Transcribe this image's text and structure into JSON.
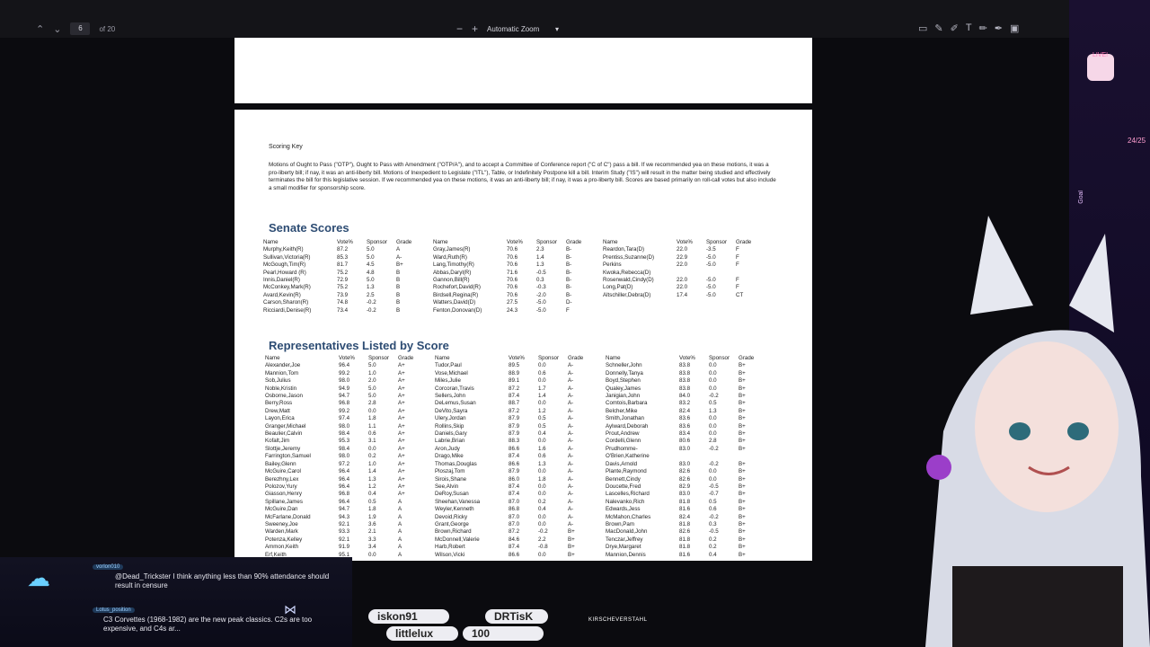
{
  "toolbar": {
    "page_current": "6",
    "page_total": "of 20",
    "zoom_label": "Automatic Zoom",
    "zoom_out": "−",
    "zoom_in": "+"
  },
  "doc": {
    "scoring_title": "Scoring Key",
    "scoring_text": "Motions of Ought to Pass (\"OTP\"), Ought to Pass with Amendment (\"OTP/A\"), and to accept a Committee of Conference report (\"C of C\") pass a bill. If we recommended yea on these motions, it was a pro-liberty bill; if nay, it was an anti-liberty bill. Motions of Inexpedient to Legislate (\"ITL\"), Table, or Indefinitely Postpone kill a bill. Interim Study (\"IS\") will result in the matter being studied and effectively terminates the bill for this legislative session. If we recommended yea on these motions, it was an anti-liberty bill; if nay, it was a pro-liberty bill. Scores are based primarily on roll-call votes but also include a small modifier for sponsorship score.",
    "senate_title": "Senate Scores",
    "reps_title": "Representatives Listed by Score",
    "headers": [
      "Name",
      "Vote%",
      "Sponsor",
      "Grade"
    ],
    "senate": [
      [
        [
          "Murphy,Keith(R)",
          "87.2",
          "5.0",
          "A"
        ],
        [
          "Sullivan,Victoria(R)",
          "85.3",
          "5.0",
          "A-"
        ],
        [
          "McGough,Tim(R)",
          "81.7",
          "4.5",
          "B+"
        ],
        [
          "Pearl,Howard (R)",
          "75.2",
          "4.8",
          "B"
        ],
        [
          "Innis,Daniel(R)",
          "72.9",
          "5.0",
          "B"
        ],
        [
          "McConkey,Mark(R)",
          "75.2",
          "1.3",
          "B"
        ],
        [
          "Avard,Kevin(R)",
          "73.9",
          "2.5",
          "B"
        ],
        [
          "Carson,Sharon(R)",
          "74.8",
          "-0.2",
          "B"
        ],
        [
          "Ricciardi,Denise(R)",
          "73.4",
          "-0.2",
          "B"
        ]
      ],
      [
        [
          "Gray,James(R)",
          "70.6",
          "2.3",
          "B-"
        ],
        [
          "Ward,Ruth(R)",
          "70.6",
          "1.4",
          "B-"
        ],
        [
          "Lang,Timothy(R)",
          "70.6",
          "1.3",
          "B-"
        ],
        [
          "Abbas,Daryl(R)",
          "71.6",
          "-0.5",
          "B-"
        ],
        [
          "Gannon,Bill(R)",
          "70.6",
          "0.3",
          "B-"
        ],
        [
          "Rochefort,David(R)",
          "70.6",
          "-0.3",
          "B-"
        ],
        [
          "Birdsell,Regina(R)",
          "70.6",
          "-2.0",
          "B-"
        ],
        [
          "Watters,David(D)",
          "27.5",
          "-5.0",
          "D-"
        ],
        [
          "Fenton,Donovan(D)",
          "24.3",
          "-5.0",
          "F"
        ]
      ],
      [
        [
          "Reardon,Tara(D)",
          "22.0",
          "-3.5",
          "F"
        ],
        [
          "Prentiss,Suzanne(D)",
          "22.9",
          "-5.0",
          "F"
        ],
        [
          "Perkins",
          "22.0",
          "-5.0",
          "F"
        ],
        [
          "Kwoka,Rebecca(D)",
          "",
          "",
          ""
        ],
        [
          "Rosenwald,Cindy(D)",
          "22.0",
          "-5.0",
          "F"
        ],
        [
          "Long,Pat(D)",
          "22.0",
          "-5.0",
          "F"
        ],
        [
          "Altschiller,Debra(D)",
          "17.4",
          "-5.0",
          "CT"
        ]
      ]
    ],
    "reps": [
      [
        [
          "Alexander,Joe",
          "96.4",
          "5.0",
          "A+"
        ],
        [
          "Mannion,Tom",
          "99.2",
          "1.0",
          "A+"
        ],
        [
          "Sob,Julius",
          "98.0",
          "2.0",
          "A+"
        ],
        [
          "Noble,Kristin",
          "94.9",
          "5.0",
          "A+"
        ],
        [
          "Osborne,Jason",
          "94.7",
          "5.0",
          "A+"
        ],
        [
          "Berry,Ross",
          "96.8",
          "2.8",
          "A+"
        ],
        [
          "Drew,Matt",
          "99.2",
          "0.0",
          "A+"
        ],
        [
          "Layon,Erica",
          "97.4",
          "1.8",
          "A+"
        ],
        [
          "Granger,Michael",
          "98.0",
          "1.1",
          "A+"
        ],
        [
          "Beaulier,Calvin",
          "98.4",
          "0.6",
          "A+"
        ],
        [
          "Kofalt,Jim",
          "95.3",
          "3.1",
          "A+"
        ],
        [
          "Slottje,Jeremy",
          "98.4",
          "0.0",
          "A+"
        ],
        [
          "Farrington,Samuel",
          "98.0",
          "0.2",
          "A+"
        ],
        [
          "Bailey,Glenn",
          "97.2",
          "1.0",
          "A+"
        ],
        [
          "McGuire,Carol",
          "96.4",
          "1.4",
          "A+"
        ],
        [
          "Berezhny,Lex",
          "96.4",
          "1.3",
          "A+"
        ],
        [
          "Polozov,Yury",
          "96.4",
          "1.2",
          "A+"
        ],
        [
          "Giasson,Henry",
          "96.8",
          "0.4",
          "A+"
        ],
        [
          "Spillane,James",
          "96.4",
          "0.5",
          "A"
        ],
        [
          "McGuire,Dan",
          "94.7",
          "1.8",
          "A"
        ],
        [
          "McFarlane,Donald",
          "94.3",
          "1.9",
          "A"
        ],
        [
          "Sweeney,Joe",
          "92.1",
          "3.6",
          "A"
        ],
        [
          "Warden,Mark",
          "93.3",
          "2.1",
          "A"
        ],
        [
          "Potenza,Kelley",
          "92.1",
          "3.3",
          "A"
        ],
        [
          "Ammon,Keith",
          "91.9",
          "3.4",
          "A"
        ],
        [
          "Erf,Keith",
          "95.1",
          "0.0",
          "A"
        ]
      ],
      [
        [
          "Tudor,Paul",
          "89.5",
          "0.0",
          "A-"
        ],
        [
          "Vose,Michael",
          "88.9",
          "0.6",
          "A-"
        ],
        [
          "Miles,Julie",
          "89.1",
          "0.0",
          "A-"
        ],
        [
          "Corcoran,Travis",
          "87.2",
          "1.7",
          "A-"
        ],
        [
          "Sellers,John",
          "87.4",
          "1.4",
          "A-"
        ],
        [
          "DeLemus,Susan",
          "88.7",
          "0.0",
          "A-"
        ],
        [
          "DeVito,Sayra",
          "87.2",
          "1.2",
          "A-"
        ],
        [
          "Ulery,Jordan",
          "87.9",
          "0.5",
          "A-"
        ],
        [
          "Rollins,Skip",
          "87.9",
          "0.5",
          "A-"
        ],
        [
          "Daniels,Gary",
          "87.9",
          "0.4",
          "A-"
        ],
        [
          "Labrie,Brian",
          "88.3",
          "0.0",
          "A-"
        ],
        [
          "Aron,Judy",
          "86.6",
          "1.6",
          "A-"
        ],
        [
          "Drago,Mike",
          "87.4",
          "0.6",
          "A-"
        ],
        [
          "Thomas,Douglas",
          "86.6",
          "1.3",
          "A-"
        ],
        [
          "Ploszaj,Tom",
          "87.9",
          "0.0",
          "A-"
        ],
        [
          "Sirois,Shane",
          "86.0",
          "1.8",
          "A-"
        ],
        [
          "See,Alvin",
          "87.4",
          "0.0",
          "A-"
        ],
        [
          "DeRoy,Susan",
          "87.4",
          "0.0",
          "A-"
        ],
        [
          "Sheehan,Vanessa",
          "87.0",
          "0.2",
          "A-"
        ],
        [
          "Weyler,Kenneth",
          "86.8",
          "0.4",
          "A-"
        ],
        [
          "Devoid,Ricky",
          "87.0",
          "0.0",
          "A-"
        ],
        [
          "Grant,George",
          "87.0",
          "0.0",
          "A-"
        ],
        [
          "Brown,Richard",
          "87.2",
          "-0.2",
          "B+"
        ],
        [
          "McDonnell,Valerie",
          "84.6",
          "2.2",
          "B+"
        ],
        [
          "Harb,Robert",
          "87.4",
          "-0.8",
          "B+"
        ],
        [
          "Wilson,Vicki",
          "86.6",
          "0.0",
          "B+"
        ]
      ],
      [
        [
          "Schneller,John",
          "83.8",
          "0.0",
          "B+"
        ],
        [
          "Donnelly,Tanya",
          "83.8",
          "0.0",
          "B+"
        ],
        [
          "Boyd,Stephen",
          "83.8",
          "0.0",
          "B+"
        ],
        [
          "Qualey,James",
          "83.8",
          "0.0",
          "B+"
        ],
        [
          "Janigian,John",
          "84.0",
          "-0.2",
          "B+"
        ],
        [
          "Comtois,Barbara",
          "83.2",
          "0.5",
          "B+"
        ],
        [
          "Belcher,Mike",
          "82.4",
          "1.3",
          "B+"
        ],
        [
          "Smith,Jonathan",
          "83.6",
          "0.0",
          "B+"
        ],
        [
          "Aylward,Deborah",
          "83.6",
          "0.0",
          "B+"
        ],
        [
          "Prout,Andrew",
          "83.4",
          "0.0",
          "B+"
        ],
        [
          "Cordelli,Glenn",
          "80.6",
          "2.8",
          "B+"
        ],
        [
          "Prudhomme-",
          "83.0",
          "-0.2",
          "B+"
        ],
        [
          "O'Brien,Katherine",
          "",
          "",
          ""
        ],
        [
          "Davis,Arnold",
          "83.0",
          "-0.2",
          "B+"
        ],
        [
          "Plante,Raymond",
          "82.6",
          "0.0",
          "B+"
        ],
        [
          "Bennett,Cindy",
          "82.6",
          "0.0",
          "B+"
        ],
        [
          "Doucette,Fred",
          "82.9",
          "-0.5",
          "B+"
        ],
        [
          "Lascelles,Richard",
          "83.0",
          "-0.7",
          "B+"
        ],
        [
          "Nalevanko,Rich",
          "81.8",
          "0.5",
          "B+"
        ],
        [
          "Edwards,Jess",
          "81.6",
          "0.6",
          "B+"
        ],
        [
          "McMahon,Charles",
          "82.4",
          "-0.2",
          "B+"
        ],
        [
          "Brown,Pam",
          "81.8",
          "0.3",
          "B+"
        ],
        [
          "MacDonald,John",
          "82.6",
          "-0.5",
          "B+"
        ],
        [
          "Tenczar,Jeffrey",
          "81.8",
          "0.2",
          "B+"
        ],
        [
          "Drye,Margaret",
          "81.8",
          "0.2",
          "B+"
        ],
        [
          "Mannion,Dennis",
          "81.6",
          "0.4",
          "B+"
        ]
      ]
    ]
  },
  "chat": {
    "messages": [
      {
        "user": "vorlon010",
        "text": "@Dead_Trickster I think anything less than 90% attendance should result in censure"
      },
      {
        "user": "Lotus_position",
        "text": "C3 Corvettes (1968-1982) are the new peak classics. C2s are too expensive, and C4s ar..."
      }
    ]
  },
  "overlay": {
    "goals": [
      {
        "name": "iskon91"
      },
      {
        "name": "DRTisK"
      },
      {
        "name": "littlelux"
      },
      {
        "amount": "100"
      }
    ],
    "handle": "KIRSCHEVERSTAHL",
    "live": "LIVE!",
    "counter": "24/25",
    "goal_label": "Goal"
  }
}
